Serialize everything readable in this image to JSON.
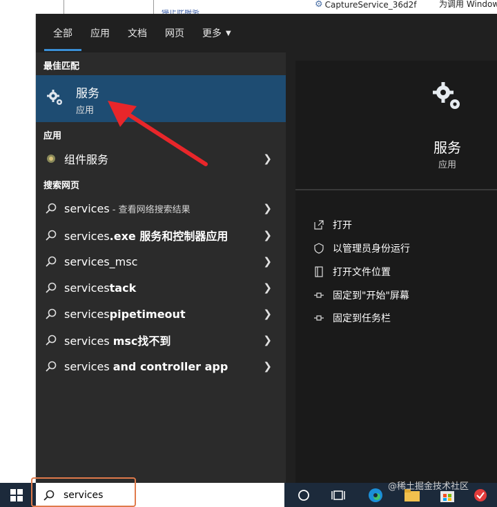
{
  "background": {
    "service_name": "CaptureService_36d2f",
    "service_desc": "为调用 Window",
    "link_text": "停止此服务"
  },
  "tabs": [
    {
      "label": "全部"
    },
    {
      "label": "应用"
    },
    {
      "label": "文档"
    },
    {
      "label": "网页"
    },
    {
      "label": "更多"
    }
  ],
  "best_match": {
    "section": "最佳匹配",
    "title": "服务",
    "subtitle": "应用"
  },
  "apps": {
    "section": "应用",
    "items": [
      {
        "label": "组件服务"
      }
    ]
  },
  "web": {
    "section": "搜索网页",
    "items": [
      {
        "prefix": "services",
        "bold": "",
        "suffix": " - 查看网络搜索结果"
      },
      {
        "prefix": "services",
        "bold": ".exe 服务和控制器应用",
        "suffix": ""
      },
      {
        "prefix": "services_msc",
        "bold": "",
        "suffix": ""
      },
      {
        "prefix": "services",
        "bold": "tack",
        "suffix": ""
      },
      {
        "prefix": "services",
        "bold": "pipetimeout",
        "suffix": ""
      },
      {
        "prefix": "services ",
        "bold": "msc找不到",
        "suffix": ""
      },
      {
        "prefix": "services ",
        "bold": "and controller app",
        "suffix": ""
      }
    ]
  },
  "detail": {
    "title": "服务",
    "subtitle": "应用",
    "actions": [
      {
        "label": "打开",
        "icon": "open-icon"
      },
      {
        "label": "以管理员身份运行",
        "icon": "shield-icon"
      },
      {
        "label": "打开文件位置",
        "icon": "file-location-icon"
      },
      {
        "label": "固定到\"开始\"屏幕",
        "icon": "pin-icon"
      },
      {
        "label": "固定到任务栏",
        "icon": "pin-icon"
      }
    ]
  },
  "search": {
    "value": "services"
  },
  "watermark": "@稀土掘金技术社区",
  "colors": {
    "accent": "#3a8fd6",
    "selection": "#1e4c72",
    "annotation": "#e8262a"
  }
}
